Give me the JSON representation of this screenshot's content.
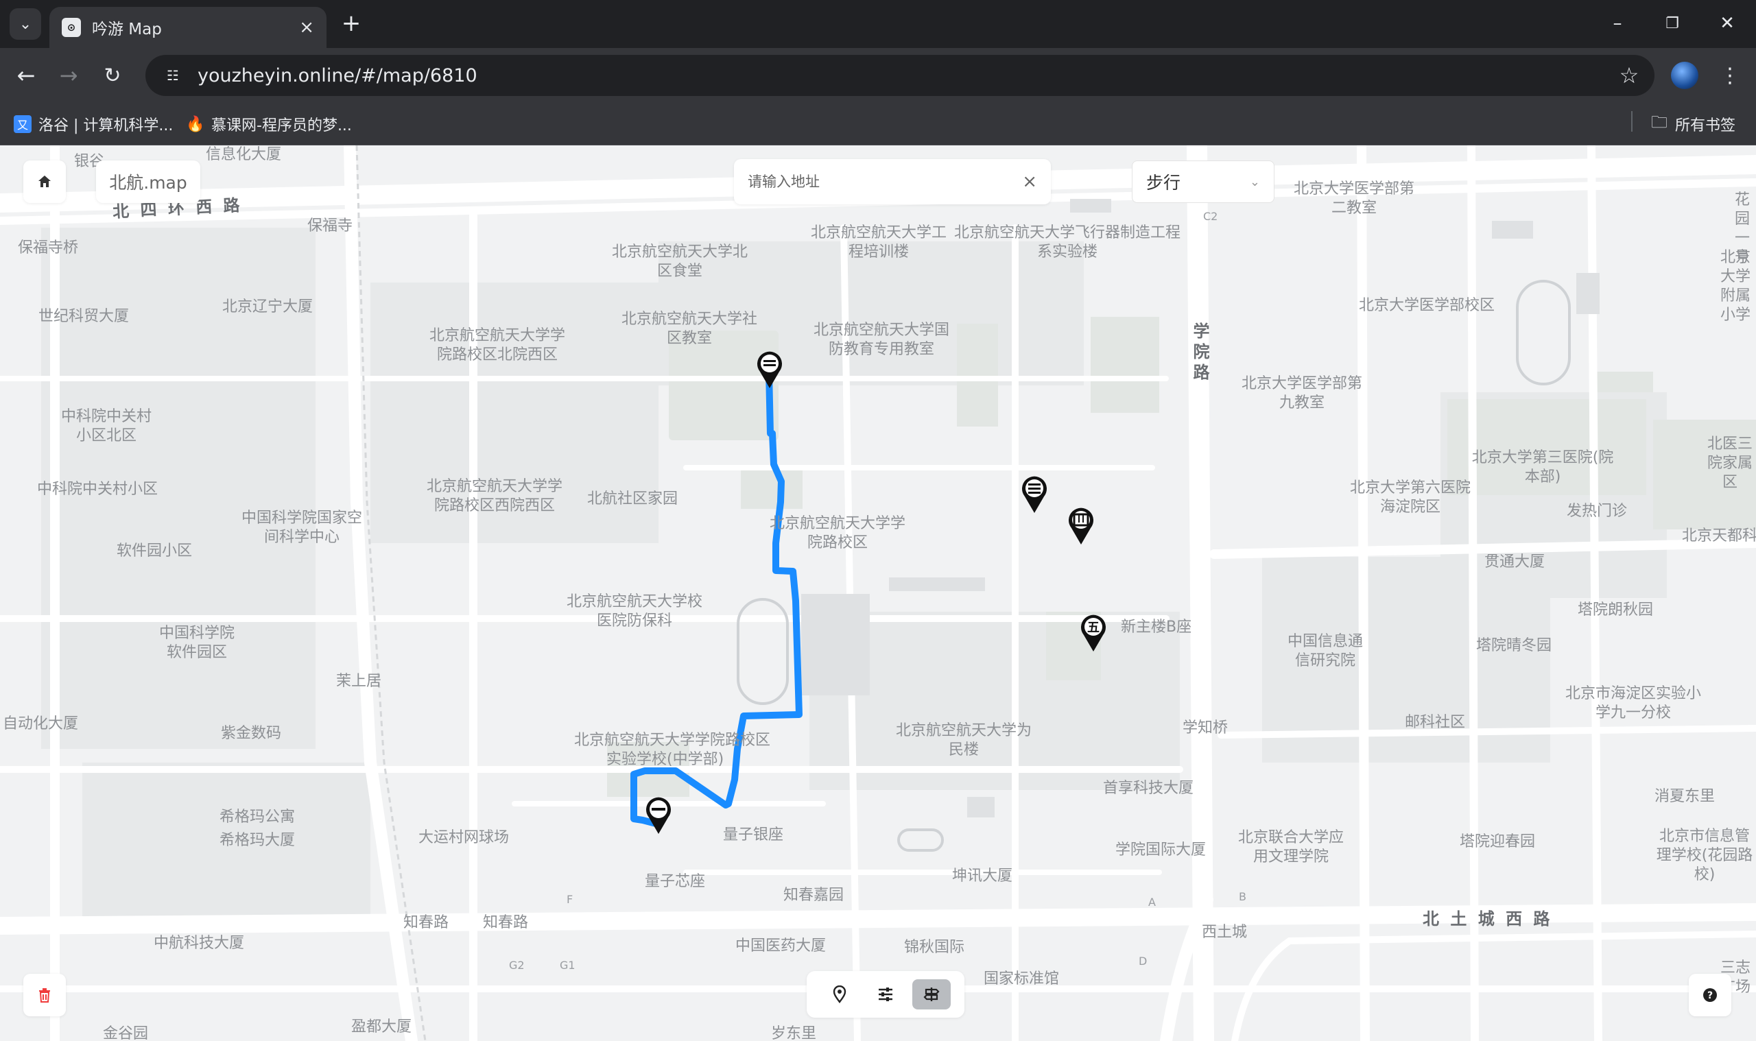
{
  "browser": {
    "tab_title": "吟游 Map",
    "url": "youzheyin.online/#/map/6810",
    "bookmarks": [
      {
        "label": "洛谷 | 计算机科学...",
        "color": "#3b8cff"
      },
      {
        "label": "慕课网-程序员的梦...",
        "color": "#f03c2e"
      }
    ],
    "all_bookmarks": "所有书签"
  },
  "map_ui": {
    "brand": "北航.map",
    "address_placeholder": "请输入地址",
    "travel_mode": "步行",
    "marker_label": "新主楼B座"
  },
  "map_labels": {
    "roads": {
      "north_west_ring": "北 四 环 西 路",
      "xueyuan": "学院路",
      "north_tucheng": "北 土 城 西 路",
      "zhichun_1": "知春路",
      "zhichun_2": "知春路"
    },
    "places": [
      "银谷",
      "信息化大厦",
      "保福寺",
      "保福寺桥",
      "世纪科贸大厦",
      "北京辽宁大厦",
      "中科院中关村小区北区",
      "中科院中关村小区",
      "中国科学院国家空间科学中心",
      "软件园小区",
      "中国科学院软件园区",
      "茉上居",
      "自动化大厦",
      "紫金数码",
      "希格玛公寓",
      "希格玛大厦",
      "大运村网球场",
      "中航科技大厦",
      "盈都大厦",
      "金谷园",
      "北京航空航天大学北区食堂",
      "北京航空航天大学社区教室",
      "北京航空航天大学学院路校区北院西区",
      "北京航空航天大学工程培训楼",
      "北京航空航天大学飞行器制造工程系实验楼",
      "北京航空航天大学国防教育专用教室",
      "北京航空航天大学学院路校区西院西区",
      "北航社区家园",
      "北京航空航天大学学院路校区",
      "北京航空航天大学校医院防保科",
      "北京航空航天大学学院路校区",
      "实验学校(中学部)",
      "北京航空航天大学为民楼",
      "量子银座",
      "量子芯座",
      "知春嘉园",
      "坤讯大厦",
      "中国医药大厦",
      "锦秋国际",
      "国家标准馆",
      "岁东里",
      "北京大学医学部第二教室",
      "北京大学医学部校区",
      "北京大学医学部第九教室",
      "北京大学第三医院(院本部)",
      "北京大学第六医院海淀院区",
      "发热门诊",
      "贯通大厦",
      "塔院朗秋园",
      "中国信息通信研究院",
      "塔院晴冬园",
      "北京市海淀区实验小学九一分校",
      "邮科社区",
      "学知桥",
      "首享科技大厦",
      "学院国际大厦",
      "北京联合大学应用文理学院",
      "塔院迎春园",
      "北京市信息管理学校(花园路校)",
      "消夏东里",
      "西土城",
      "北医三院家属区",
      "北京天都科",
      "北京大学附属小学",
      "花园一号",
      "三志广场"
    ]
  },
  "route": {
    "mode": "walking"
  }
}
